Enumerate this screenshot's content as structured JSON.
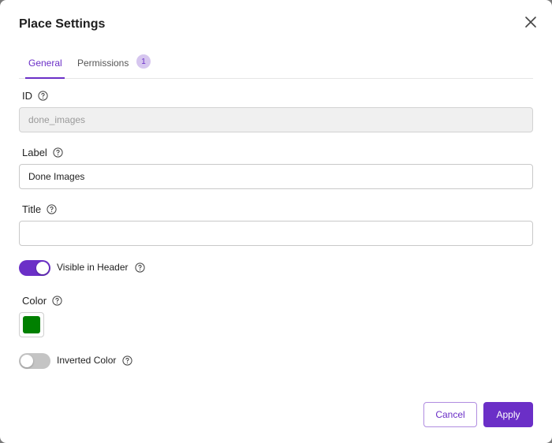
{
  "dialog": {
    "title": "Place Settings",
    "close_icon": "close-icon"
  },
  "tabs": [
    {
      "label": "General",
      "active": true
    },
    {
      "label": "Permissions",
      "active": false,
      "badge": "1"
    }
  ],
  "fields": {
    "id": {
      "label": "ID",
      "value": "done_images",
      "disabled": true
    },
    "label": {
      "label": "Label",
      "value": "Done Images"
    },
    "title": {
      "label": "Title",
      "value": ""
    },
    "visible_in_header": {
      "label": "Visible in Header",
      "on": true
    },
    "color": {
      "label": "Color",
      "value": "#008000"
    },
    "inverted_color": {
      "label": "Inverted Color",
      "on": false
    }
  },
  "buttons": {
    "cancel": "Cancel",
    "apply": "Apply"
  },
  "colors": {
    "accent": "#6b2fc7",
    "toggle_off": "#c4c4c4"
  }
}
